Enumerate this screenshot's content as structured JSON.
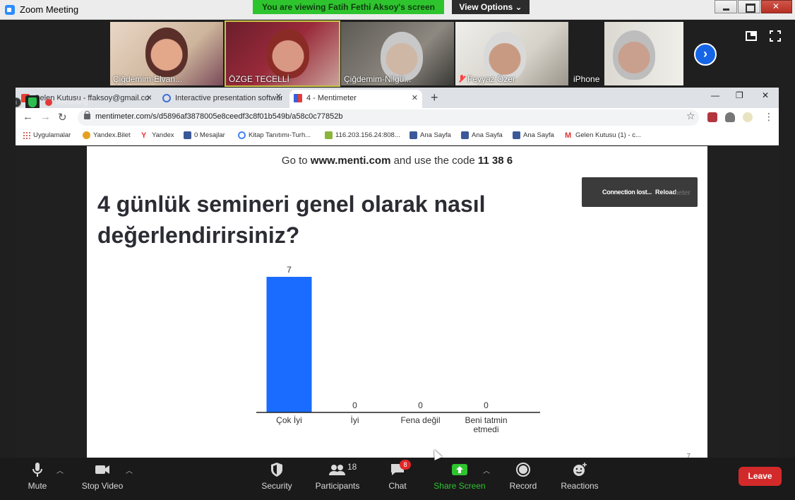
{
  "window": {
    "title": "Zoom Meeting",
    "viewing_banner": "You are viewing Fatih Fethi Aksoy's screen",
    "view_options": "View Options ⌄"
  },
  "participants": [
    {
      "name": "Çiğdemim-Elvan..."
    },
    {
      "name": "ÖZGE TECELLİ"
    },
    {
      "name": "Çiğdemim-Nilgü..."
    },
    {
      "name": "Feyyaz Özer"
    },
    {
      "name": "iPhone"
    }
  ],
  "recording_label": "Recording",
  "browser": {
    "tabs": [
      {
        "label": "Gelen Kutusu - ffaksoy@gmail.co"
      },
      {
        "label": "Interactive presentation software"
      },
      {
        "label": "4 - Mentimeter"
      }
    ],
    "url": "mentimeter.com/s/d5896af3878005e8ceedf3c8f01b549b/a58c0c77852b",
    "bookmarks": [
      {
        "label": "Uygulamalar",
        "icon": "apps-grid-icon"
      },
      {
        "label": "Yandex.Bilet",
        "icon": "yandex-bilet-icon"
      },
      {
        "label": "Yandex",
        "icon": "yandex-icon"
      },
      {
        "label": "0 Mesajlar",
        "icon": "facebook-icon"
      },
      {
        "label": "Kitap Tanıtımı-Turh...",
        "icon": "google-icon"
      },
      {
        "label": "116.203.156.24:808...",
        "icon": "site-icon"
      },
      {
        "label": "Ana Sayfa",
        "icon": "facebook-icon"
      },
      {
        "label": "Ana Sayfa",
        "icon": "facebook-icon"
      },
      {
        "label": "Ana Sayfa",
        "icon": "facebook-icon"
      },
      {
        "label": "Gelen Kutusu (1) - c...",
        "icon": "gmail-icon"
      }
    ]
  },
  "slide": {
    "join_prefix": "Go to ",
    "join_site": "www.menti.com",
    "join_mid": " and use the code ",
    "join_code": "11 38 6",
    "question": "4 günlük semineri genel olarak nasıl değerlendirirsiniz?",
    "connection_msg": "Connection lost...",
    "reload_label": "Reload",
    "ghost_text": "neter",
    "slide_number": "7"
  },
  "chart_data": {
    "type": "bar",
    "categories": [
      "Çok İyi",
      "İyi",
      "Fena değil",
      "Beni tatmin etmedi"
    ],
    "category_lines": [
      [
        "Çok İyi"
      ],
      [
        "İyi"
      ],
      [
        "Fena değil"
      ],
      [
        "Beni tatmin",
        "etmedi"
      ]
    ],
    "values": [
      7,
      0,
      0,
      0
    ],
    "data_labels": [
      "7",
      "0",
      "0",
      "0"
    ],
    "bar_color": "#196cff",
    "ylim": [
      0,
      7
    ],
    "grid": false,
    "title": "",
    "xlabel": "",
    "ylabel": ""
  },
  "toolbar": {
    "mute": "Mute",
    "stop_video": "Stop Video",
    "security": "Security",
    "participants": "Participants",
    "participants_count": "18",
    "chat": "Chat",
    "chat_badge": "8",
    "share_screen": "Share Screen",
    "record": "Record",
    "reactions": "Reactions",
    "leave": "Leave"
  },
  "colors": {
    "share_green": "#2ec42e",
    "leave_red": "#d22a2a",
    "zoom_blue": "#2d8cff"
  }
}
